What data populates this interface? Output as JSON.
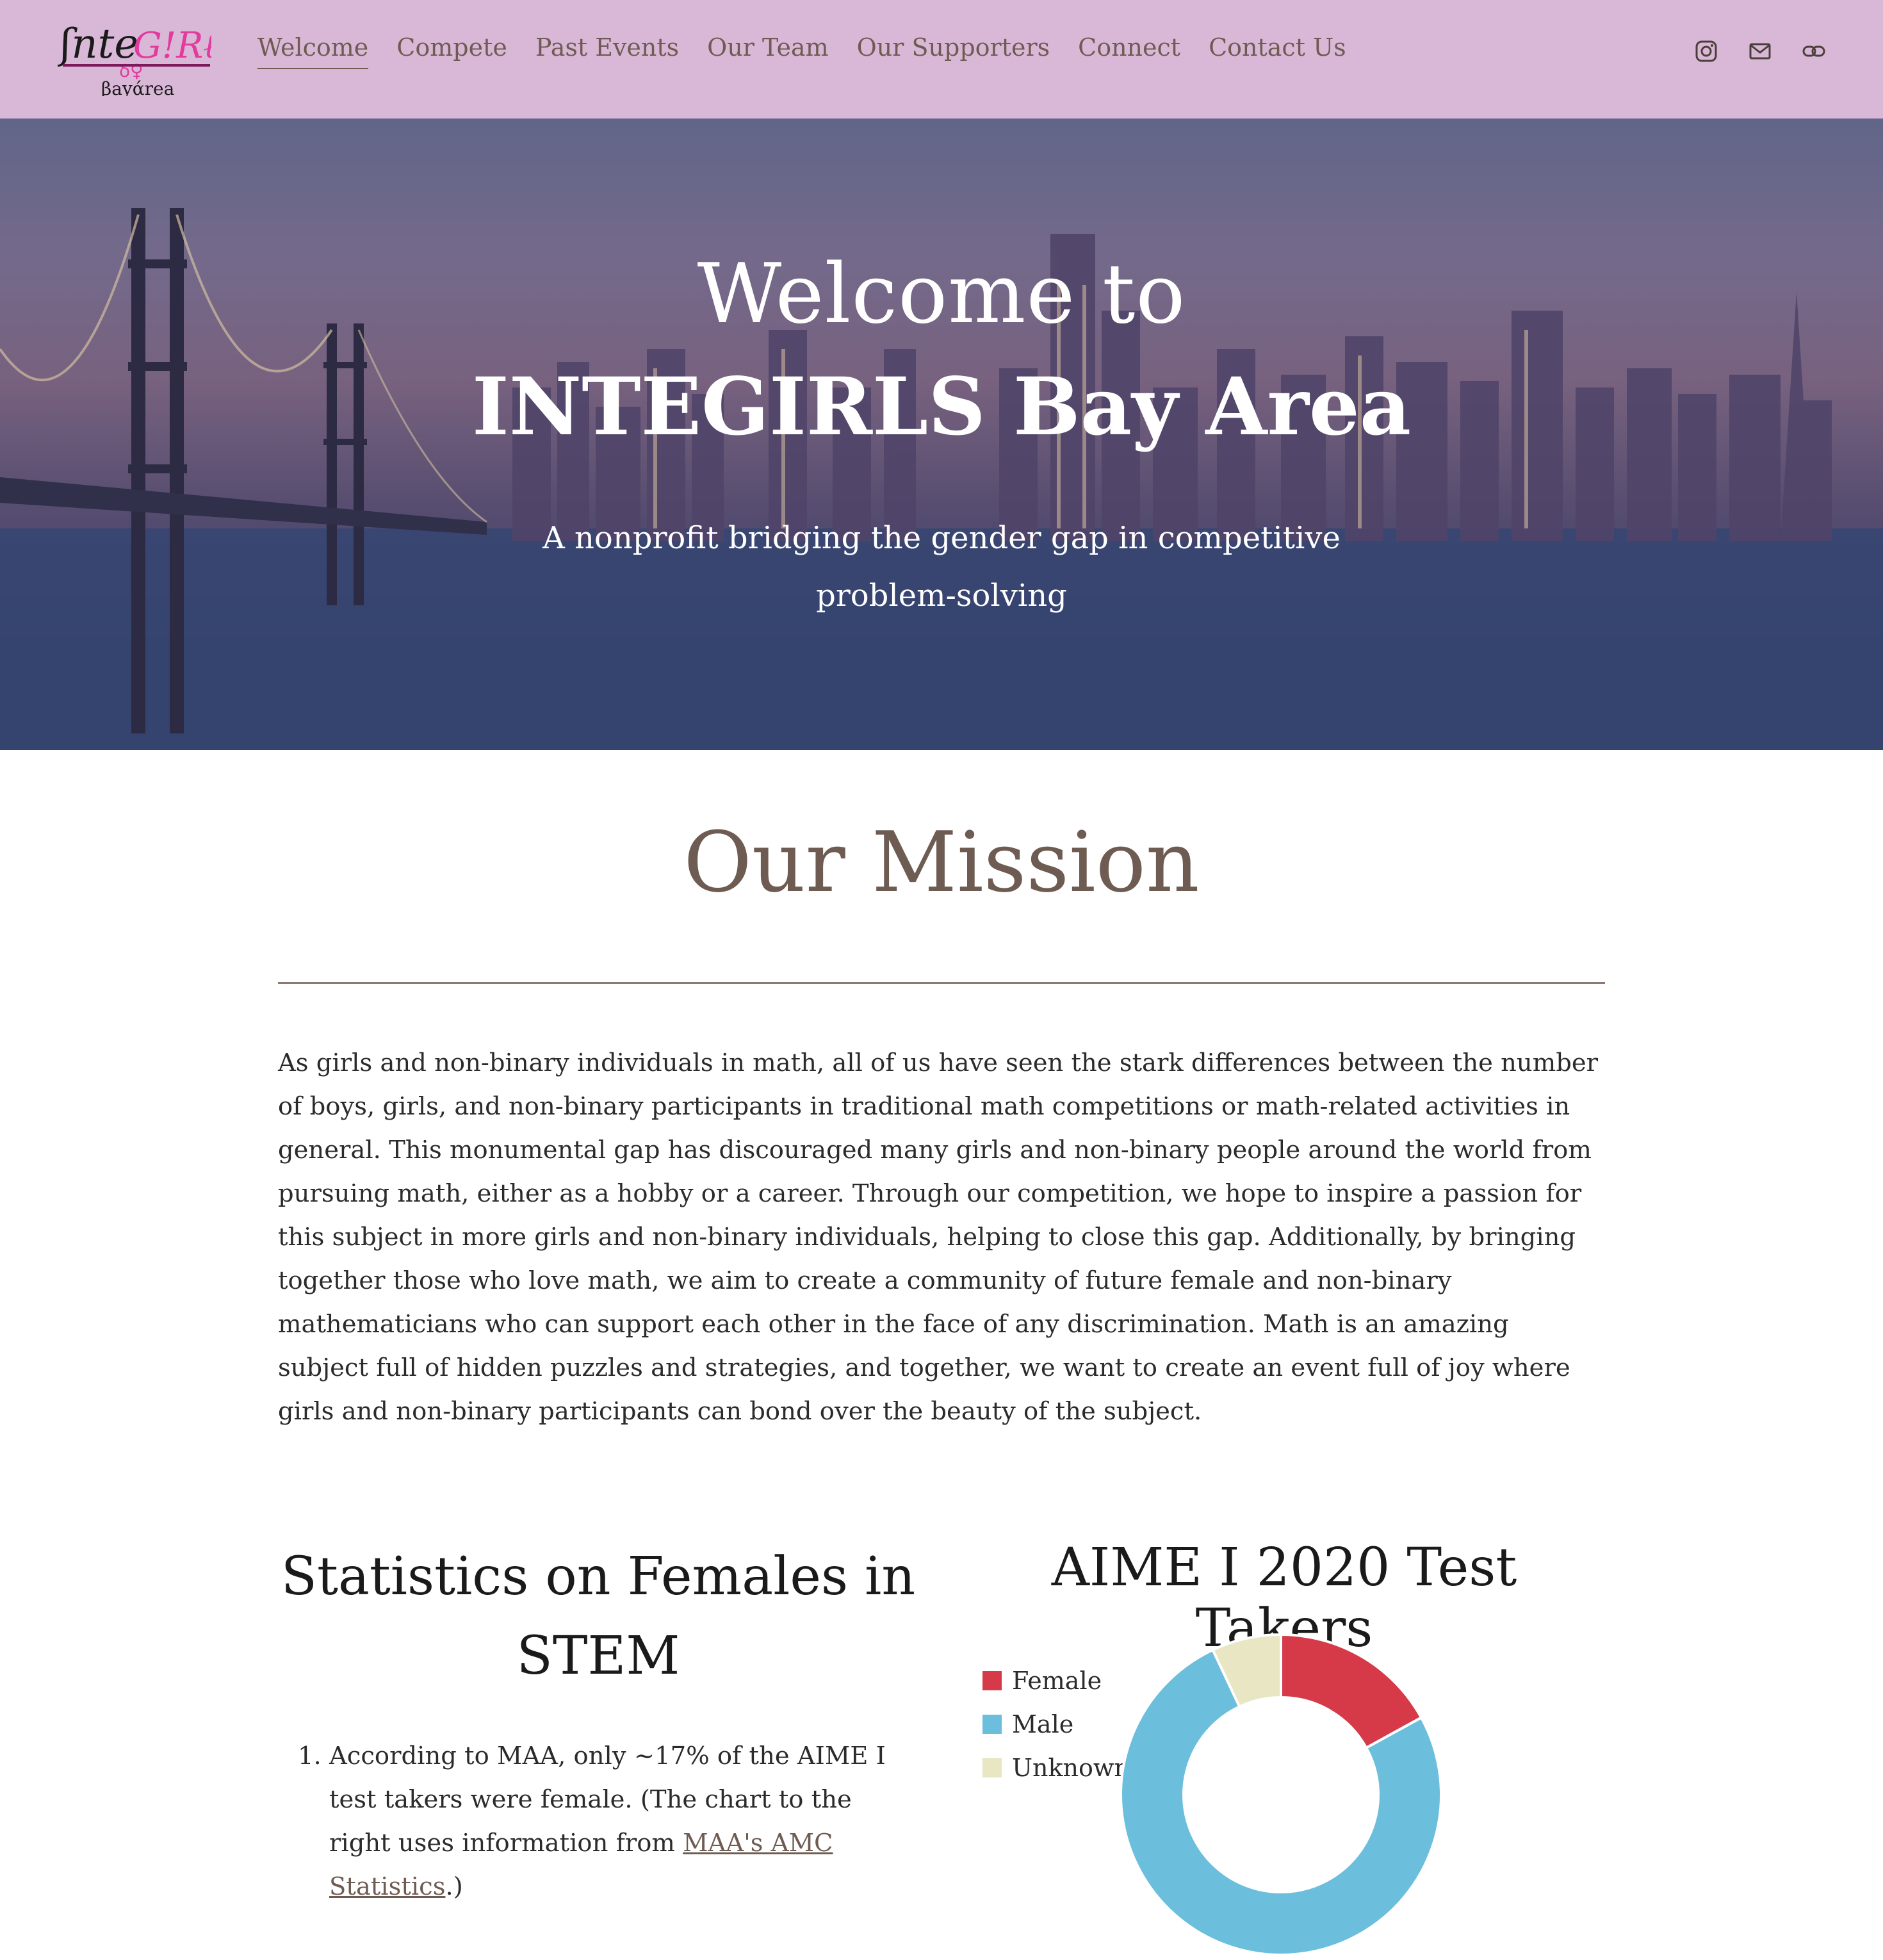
{
  "header": {
    "logo_text": "InteGIRLS",
    "logo_sub": "βayάrea",
    "nav": [
      {
        "label": "Welcome",
        "active": true
      },
      {
        "label": "Compete",
        "active": false
      },
      {
        "label": "Past Events",
        "active": false
      },
      {
        "label": "Our Team",
        "active": false
      },
      {
        "label": "Our Supporters",
        "active": false
      },
      {
        "label": "Connect",
        "active": false
      },
      {
        "label": "Contact Us",
        "active": false
      }
    ],
    "social_icons": [
      "instagram-icon",
      "email-icon",
      "link-icon"
    ]
  },
  "hero": {
    "line1": "Welcome to",
    "line2": "INTEGIRLS Bay Area",
    "subtitle": "A nonprofit bridging the gender gap in competitive problem-solving"
  },
  "mission": {
    "title": "Our Mission",
    "text": "As girls and non-binary individuals in math, all of us have seen the stark differences between the number of boys, girls, and non-binary participants in traditional math competitions or math-related activities in general. This monumental gap has discouraged many girls and non-binary people around the world from pursuing math, either as a hobby or a career. Through our competition, we hope to inspire a passion for this subject in more girls and non-binary individuals, helping to close this gap. Additionally, by bringing together those who love math, we aim to create a community of future female and non-binary mathematicians who can support each other in the face of any discrimination. Math is an amazing subject full of hidden puzzles and strategies, and together, we want to create an event full of joy where girls and non-binary participants can bond over the beauty of the subject."
  },
  "stats": {
    "title": "Statistics on Females in STEM",
    "item1_before": "According to MAA, only ~17% of the AIME I test takers were female. (The chart to the right uses information from ",
    "item1_link": "MAA's AMC Statistics",
    "item1_after": ".)"
  },
  "colors": {
    "header_bg": "#d9b8d7",
    "accent_brown": "#6e5b52",
    "female": "#d63a48",
    "male": "#6bbedc",
    "unknown": "#e8e6c3"
  },
  "chart_data": {
    "type": "pie",
    "title": "AIME I 2020 Test Takers",
    "legend_position": "left",
    "categories": [
      "Female",
      "Male",
      "Unknown"
    ],
    "values": [
      17,
      76,
      7
    ]
  }
}
